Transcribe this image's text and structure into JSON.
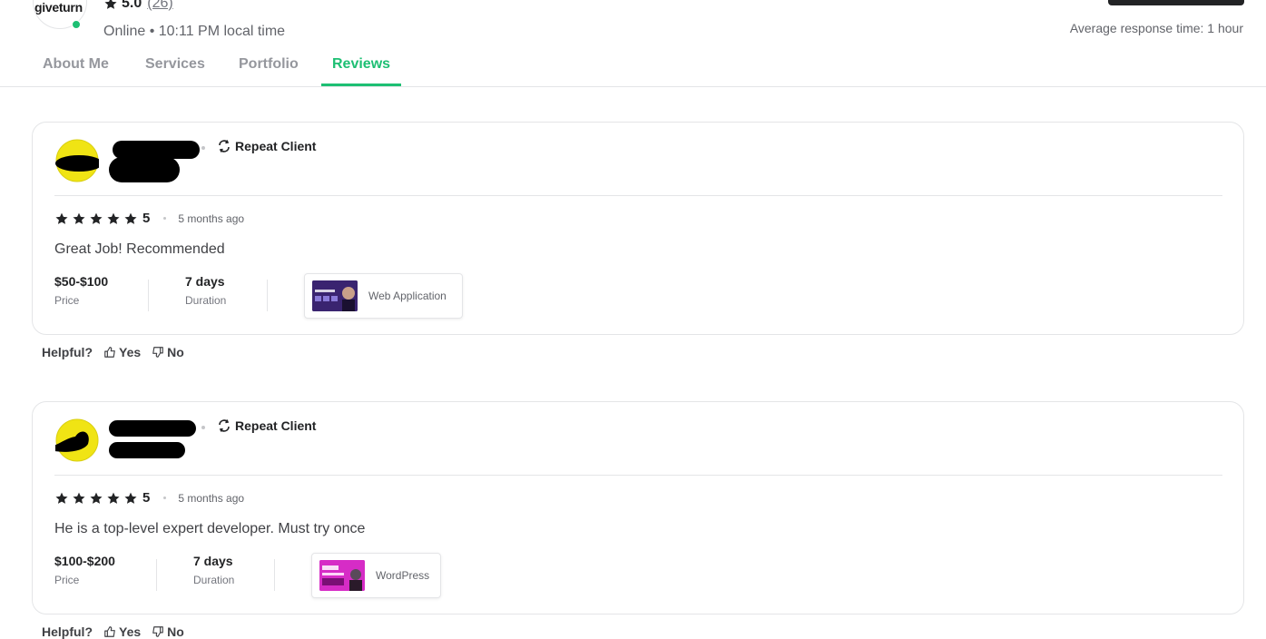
{
  "seller": {
    "logo_text": "giveturn",
    "rating": "5.0",
    "review_count": "(26)",
    "status_line": "Online • 10:11 PM local time",
    "average_response": "Average response time: 1 hour"
  },
  "tabs": [
    {
      "label": "About Me",
      "active": false
    },
    {
      "label": "Services",
      "active": false
    },
    {
      "label": "Portfolio",
      "active": false
    },
    {
      "label": "Reviews",
      "active": true
    }
  ],
  "colors": {
    "accent": "#1dbf73",
    "star": "#222325",
    "avatar_yellow": "#f0e414"
  },
  "reviews": [
    {
      "badge": "Repeat Client",
      "score": "5",
      "time_ago": "5 months ago",
      "comment": "Great Job! Recommended",
      "price_value": "$50-$100",
      "price_label": "Price",
      "duration_value": "7 days",
      "duration_label": "Duration",
      "gig_title": "Web Application"
    },
    {
      "badge": "Repeat Client",
      "score": "5",
      "time_ago": "5 months ago",
      "comment": "He is a top-level expert developer. Must try once",
      "price_value": "$100-$200",
      "price_label": "Price",
      "duration_value": "7 days",
      "duration_label": "Duration",
      "gig_title": "WordPress"
    }
  ],
  "helpful": {
    "label": "Helpful?",
    "yes": "Yes",
    "no": "No"
  }
}
